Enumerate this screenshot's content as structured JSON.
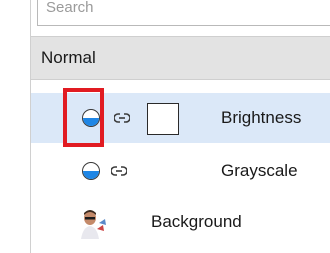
{
  "search": {
    "placeholder": "Search"
  },
  "blend_mode": {
    "label": "Normal"
  },
  "layers": [
    {
      "name": "Brightness",
      "selected": true,
      "visibility_icon": "visibility-icon",
      "link_icon": "link-icon",
      "thumbnail": "white-square-thumbnail"
    },
    {
      "name": "Grayscale",
      "selected": false,
      "visibility_icon": "visibility-icon",
      "link_icon": "link-icon"
    },
    {
      "name": "Background",
      "selected": false,
      "thumbnail": "person-photo-thumbnail"
    }
  ],
  "colors": {
    "selection_row": "#dbe8f8",
    "highlight_annotation": "#e11b22",
    "visibility_fill": "#1f86e5",
    "blend_bar": "#e3e3e3"
  }
}
